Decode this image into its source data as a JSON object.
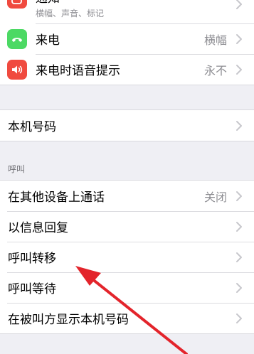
{
  "colors": {
    "background": "#efeff4",
    "notifications_icon": "#f04a3f",
    "phone_icon": "#4cd964",
    "announce_icon": "#f04a3f",
    "arrow": "#e3242b"
  },
  "top_group": {
    "items": [
      {
        "label": "通知",
        "subtitle": "横幅、声音、标记",
        "icon": "notifications-icon"
      },
      {
        "label": "来电",
        "value": "横幅",
        "icon": "phone-icon"
      },
      {
        "label": "来电时语音提示",
        "value": "永不",
        "icon": "speaker-icon"
      }
    ]
  },
  "number_group": {
    "items": [
      {
        "label": "本机号码"
      }
    ]
  },
  "calls_section": {
    "header": "呼叫",
    "items": [
      {
        "label": "在其他设备上通话",
        "value": "关闭"
      },
      {
        "label": "以信息回复"
      },
      {
        "label": "呼叫转移"
      },
      {
        "label": "呼叫等待"
      },
      {
        "label": "在被叫方显示本机号码"
      }
    ]
  },
  "annotation": {
    "type": "arrow",
    "points_to": "呼叫转移"
  }
}
